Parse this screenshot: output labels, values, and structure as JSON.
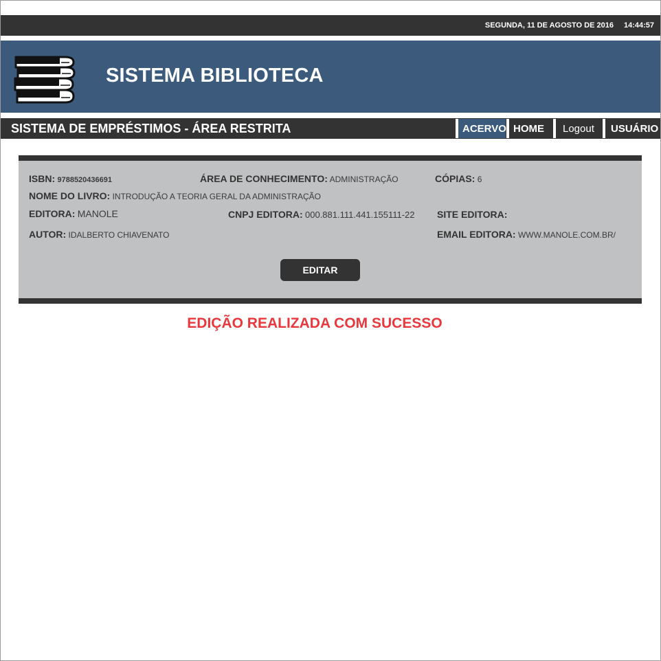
{
  "datebar": {
    "date": "SEGUNDA, 11 DE AGOSTO DE 2016",
    "time": "14:44:57"
  },
  "header": {
    "logo_icon": "books-stack-icon",
    "title": "SISTEMA BIBLIOTECA"
  },
  "navbar": {
    "subtitle": "SISTEMA DE EMPRÉSTIMOS - ÁREA RESTRITA",
    "tabs": [
      {
        "label": "ACERVO",
        "active": true
      },
      {
        "label": "HOME",
        "active": false
      },
      {
        "label": "Logout",
        "active": false
      },
      {
        "label": "USUÁRIO",
        "active": false
      }
    ]
  },
  "book": {
    "isbn": {
      "label": "ISBN:",
      "value": "9788520436691"
    },
    "area": {
      "label": "ÁREA DE CONHECIMENTO:",
      "value": "ADMINISTRAÇÃO"
    },
    "copias": {
      "label": "CÓPIAS:",
      "value": "6"
    },
    "nome": {
      "label": "NOME DO LIVRO:",
      "value": "INTRODUÇÃO A TEORIA GERAL DA ADMINISTRAÇÃO"
    },
    "editora": {
      "label": "EDITORA:",
      "value": "MANOLE"
    },
    "cnpj": {
      "label": "CNPJ EDITORA:",
      "value": "000.881.111.441.155111-22"
    },
    "site": {
      "label": "SITE EDITORA:",
      "value": ""
    },
    "autor": {
      "label": "AUTOR:",
      "value": "IDALBERTO CHIAVENATO"
    },
    "email": {
      "label": "EMAIL EDITORA:",
      "value": "WWW.MANOLE.COM.BR/"
    },
    "edit_label": "EDITAR"
  },
  "message": {
    "text": "EDIÇÃO REALIZADA COM SUCESSO",
    "color": "#e8383d"
  },
  "colors": {
    "dark": "#333333",
    "brand": "#3b5a7c",
    "panel": "#c0c1c3"
  }
}
